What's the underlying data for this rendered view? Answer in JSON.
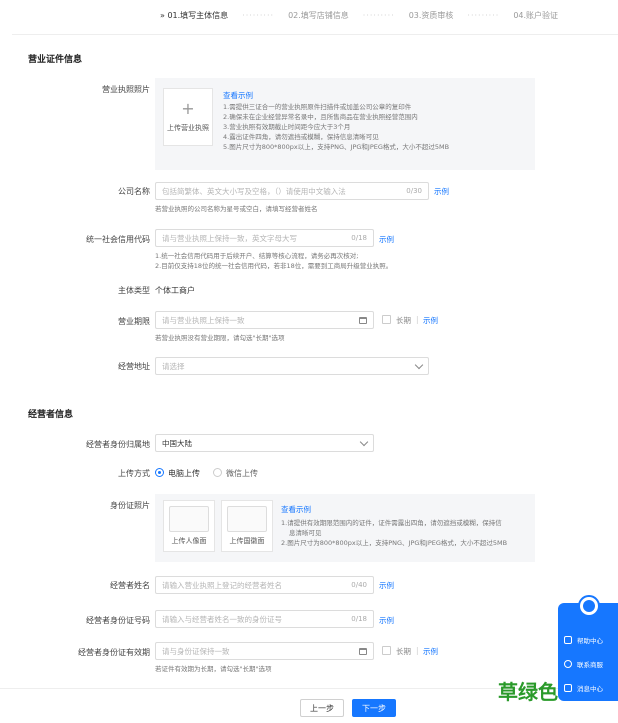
{
  "steps": [
    {
      "label": "» 01.填写主体信息",
      "active": true
    },
    {
      "label": "02.填写店铺信息",
      "active": false
    },
    {
      "label": "03.资质审核",
      "active": false
    },
    {
      "label": "04.账户验证",
      "active": false
    }
  ],
  "license_section": {
    "title": "营业证件信息",
    "photo": {
      "label": "营业执照照片",
      "upload_caption": "上传营业执照",
      "example_link": "查看示例",
      "tips": [
        "1.需提供三证合一的营业执照原件扫描件或加盖公司公章的复印件",
        "2.确保未在企业经营异常名录中，且所售商品在营业执照经营范围内",
        "3.营业执照有效期截止时间距今应大于3个月",
        "4.露出证件四角，请勿遮挡或模糊，保持信息清晰可见",
        "5.图片尺寸为800*800px以上，支持PNG、JPG和JPEG格式，大小不超过5MB"
      ]
    },
    "company_name": {
      "label": "公司名称",
      "placeholder": "包括简繁体、英文大小写及空格，（）请使用中文输入法",
      "counter": "0/30",
      "example": "示例",
      "hint": "若营业执照的公司名称为星号或空白，请填写经营者姓名"
    },
    "credit_code": {
      "label": "统一社会信用代码",
      "placeholder": "请与营业执照上保持一致，英文字母大写",
      "counter": "0/18",
      "example": "示例",
      "hints": [
        "1.统一社会信用代码用于后续开户、结算等核心流程，请务必再次核对;",
        "2.目前仅支持18位的统一社会信用代码，若非18位，需要到工商局升级营业执照。"
      ]
    },
    "entity_type": {
      "label": "主体类型",
      "value": "个体工商户"
    },
    "business_term": {
      "label": "营业期限",
      "placeholder": "请与营业执照上保持一致",
      "long_term": "长期",
      "example": "示例",
      "hint": "若营业执照没有营业期限，请勾选\"长期\"选项"
    },
    "address": {
      "label": "经营地址",
      "placeholder": "请选择"
    }
  },
  "operator_section": {
    "title": "经营者信息",
    "id_region": {
      "label": "经营者身份归属地",
      "value": "中国大陆"
    },
    "upload_method": {
      "label": "上传方式",
      "options": [
        "电脑上传",
        "微信上传"
      ],
      "selected": 0
    },
    "id_photo": {
      "label": "身份证照片",
      "front_caption": "上传人像面",
      "back_caption": "上传国徽面",
      "example_link": "查看示例",
      "tips": [
        "1.请提供有效期限范围内的证件，证件需露出四角，请勿遮挡或模糊，保持信",
        "息清晰可见",
        "2.图片尺寸为800*800px以上，支持PNG、JPG和JPEG格式，大小不超过5MB"
      ]
    },
    "operator_name": {
      "label": "经营者姓名",
      "placeholder": "请输入营业执照上登记的经营者姓名",
      "counter": "0/40",
      "example": "示例"
    },
    "id_number": {
      "label": "经营者身份证号码",
      "placeholder": "请输入与经营者姓名一致的身份证号",
      "counter": "0/18",
      "example": "示例"
    },
    "id_validity": {
      "label": "经营者身份证有效期",
      "placeholder": "请与身份证保持一致",
      "long_term": "长期",
      "example": "示例",
      "hint": "若证件有效期为长期，请勾选\"长期\"选项"
    }
  },
  "footer": {
    "prev_label": "上一步",
    "next_label": "下一步"
  },
  "float_panel": {
    "items": [
      "帮助中心",
      "联系商服",
      "消息中心"
    ]
  },
  "watermark": "草绿色",
  "colors": {
    "accent": "#1677ff",
    "watermark": "#2a9a2a"
  }
}
